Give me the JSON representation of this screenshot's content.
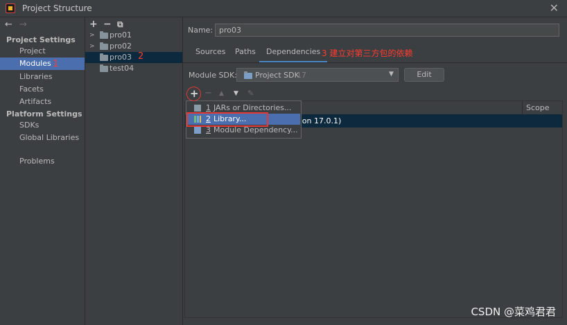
{
  "window": {
    "title": "Project Structure",
    "close_glyph": "✕"
  },
  "nav": {
    "back": "←",
    "forward": "→",
    "project_settings_header": "Project Settings",
    "project_settings_items": [
      "Project",
      "Modules",
      "Libraries",
      "Facets",
      "Artifacts"
    ],
    "platform_settings_header": "Platform Settings",
    "platform_settings_items": [
      "SDKs",
      "Global Libraries"
    ],
    "other_items": [
      "Problems"
    ],
    "annotation": "1"
  },
  "module_tree": {
    "toolbar": {
      "add": "+",
      "remove": "−",
      "copy": "⧉"
    },
    "modules": [
      {
        "name": "pro01",
        "expandable": true
      },
      {
        "name": "pro02",
        "expandable": true
      },
      {
        "name": "pro03",
        "expandable": false
      },
      {
        "name": "test04",
        "expandable": false
      }
    ],
    "annotation": "2"
  },
  "details": {
    "name_label": "Name:",
    "name_value": "pro03",
    "tabs": [
      "Sources",
      "Paths",
      "Dependencies"
    ],
    "tab_annotation": "3 建立对第三方包的依赖",
    "sdk_label": "Module SDK:",
    "sdk_value": "Project SDK",
    "sdk_version": "17",
    "edit_label": "Edit"
  },
  "dependencies": {
    "toolbar": {
      "add": "+",
      "remove": "−",
      "up": "▲",
      "down": "▼",
      "edit": "✎"
    },
    "scope_header": "Scope",
    "row_text": "sion 17.0.1)"
  },
  "popup": {
    "items": [
      {
        "num": "1",
        "label": "JARs or Directories..."
      },
      {
        "num": "2",
        "label": "Library..."
      },
      {
        "num": "3",
        "label": "Module Dependency..."
      }
    ]
  },
  "watermark": "CSDN @菜鸡君君",
  "colors": {
    "selection": "#4b6eaf",
    "inactive_selection": "#0d293e",
    "annotation_red": "#e53935"
  }
}
